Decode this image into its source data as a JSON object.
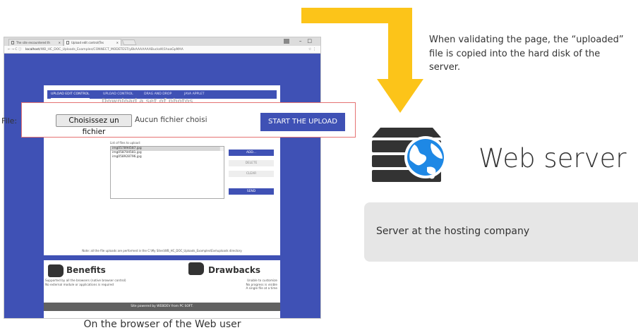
{
  "browser": {
    "tabs": [
      {
        "label": "The site encountered th"
      },
      {
        "label": "Upload edit control(Tes"
      }
    ],
    "url_host": "localhost",
    "url_path": "/WB_HC_DOC_Uploads_Examples/CONNECT_MODETEST/yBkAAAAAAABucksKt1hoaGpMAA"
  },
  "site": {
    "nav_items": [
      "UPLOAD EDIT CONTROL",
      "UPLOAD CONTROL",
      "DRAG AND DROP",
      "JAVA APPLET"
    ],
    "ghost_title": "Download a set of photos",
    "list_label": "List of files to upload:",
    "files": [
      "img057894587.jpg",
      "img058704581.jpg",
      "img058928796.jpg"
    ],
    "buttons": {
      "add": "ADD...",
      "delete": "DELETE",
      "clear": "CLEAR",
      "send": "SEND"
    },
    "note": "Note: all the file uploads are performed in the C:\\My Sites\\WB_HC_DOC_Uploads_Examples\\Exe\\uploads directory",
    "benefits_title": "Benefits",
    "benefits_lines": [
      "Supported by all the browsers (native browser control)",
      "No external module or applications is required"
    ],
    "drawbacks_title": "Drawbacks",
    "drawbacks_lines": [
      "Unable to customize",
      "No progress is visible",
      "A single file at a time"
    ],
    "footer": "Site powered by WEBDEV from PC SOFT."
  },
  "upload": {
    "file_label": "File:",
    "choose_button": "Choisissez un fichier",
    "no_file_text": "Aucun fichier choisi",
    "start_button": "START THE UPLOAD"
  },
  "annotation": {
    "top_caption": "When validating the page, the “uploaded” file is copied into the hard disk of the server.",
    "server_title": "Web server",
    "host_text": "Server at the hosting company",
    "bottom_caption": "On the browser of the Web user"
  },
  "colors": {
    "accent_blue": "#3f51b5",
    "arrow_yellow": "#fcc419",
    "globe_blue": "#1e88e5",
    "server_dark": "#333333",
    "highlight_red": "#e57373"
  }
}
